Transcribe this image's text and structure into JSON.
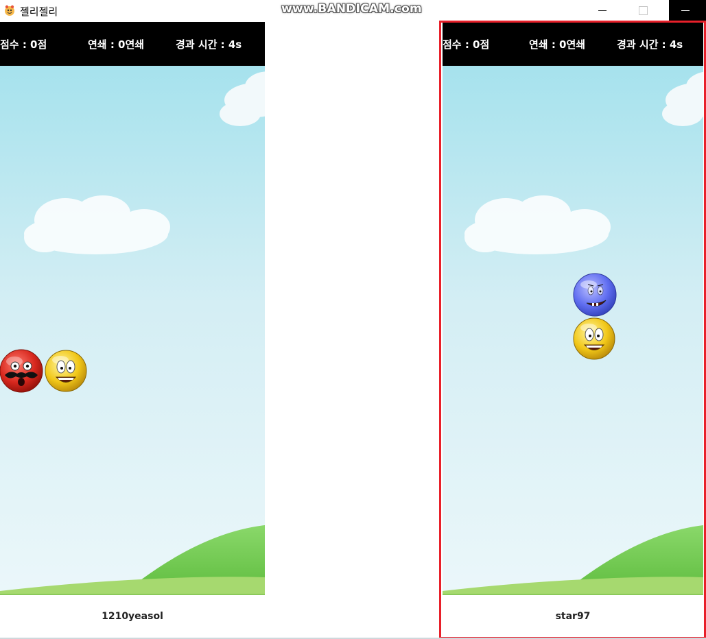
{
  "window": {
    "title": "젤리젤리",
    "icon": "jelly-app-icon",
    "buttons": [
      "minimize",
      "maximize",
      "close"
    ]
  },
  "watermark": "www.BANDICAM.com",
  "colors": {
    "hud_background": "#000000",
    "sky_top": "#a8e3ee",
    "sky_bottom": "#e8f6fa",
    "grass": "#7ccd5a",
    "highlight_border": "#e8202a"
  },
  "panels": [
    {
      "hud": {
        "score": "점수 : 0점",
        "combo": "연쇄 : 0연쇄",
        "time": "경과 시간 : 4s"
      },
      "player": "1210yeasol",
      "jellies": [
        "red-mustache-jelly",
        "yellow-smile-jelly"
      ]
    },
    {
      "hud": {
        "score": "점수 : 0점",
        "combo": "연쇄 : 0연쇄",
        "time": "경과 시간 : 4s"
      },
      "player": "star97",
      "jellies": [
        "blue-grin-jelly",
        "yellow-smile-jelly"
      ]
    }
  ]
}
